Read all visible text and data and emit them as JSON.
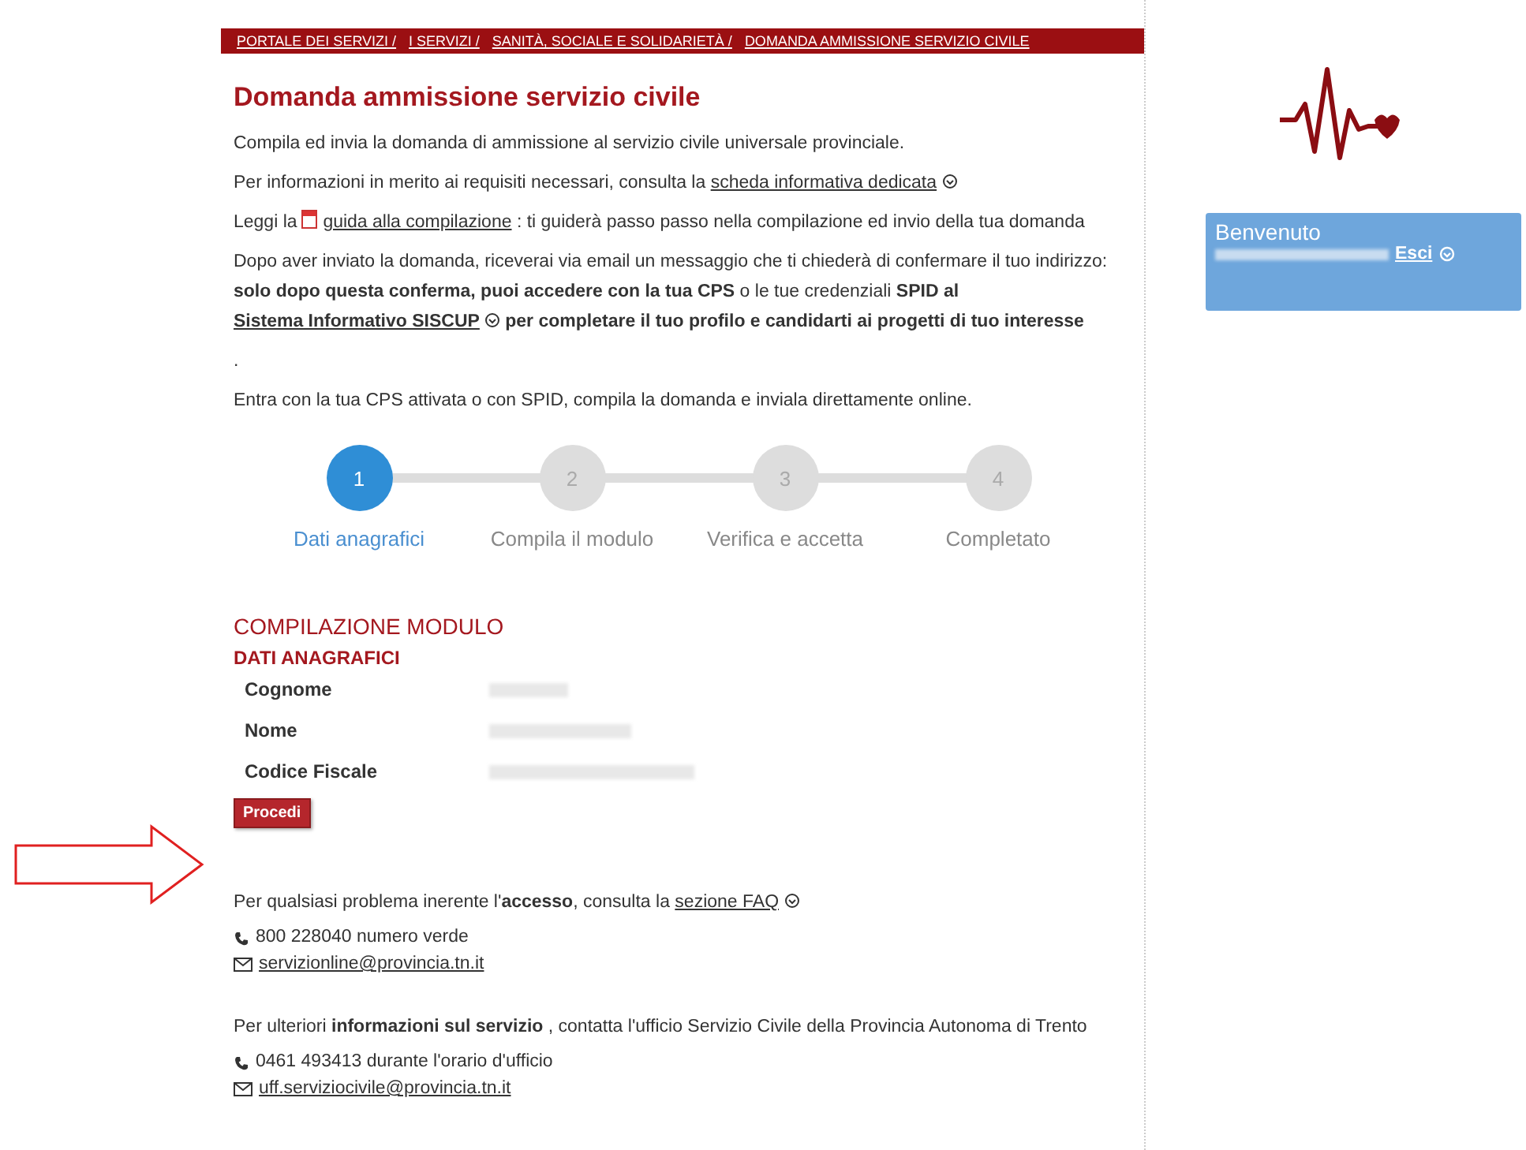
{
  "breadcrumb": [
    "PORTALE DEI SERVIZI /",
    "I SERVIZI /",
    "SANITÀ, SOCIALE E SOLIDARIETÀ /",
    "DOMANDA AMMISSIONE SERVIZIO CIVILE"
  ],
  "title": "Domanda ammissione servizio civile",
  "paragraphs": [
    [
      {
        "kind": "text",
        "text": "Compila ed invia la domanda di ammissione al servizio civile universale provinciale."
      }
    ],
    [
      {
        "kind": "text",
        "text": "Per informazioni in merito ai requisiti necessari, consulta la "
      },
      {
        "kind": "link",
        "text": "scheda informativa dedicata"
      }
    ],
    [
      {
        "kind": "text",
        "text": "Leggi la "
      },
      {
        "kind": "pdf-link",
        "text": "guida alla compilazione"
      },
      {
        "kind": "text",
        "text": " : ti guiderà passo passo nella compilazione ed invio della tua domanda"
      }
    ],
    [
      {
        "kind": "text",
        "text": "Dopo aver inviato la domanda, riceverai via email un messaggio che ti chiederà di confermare il tuo indirizzo: **solo dopo questa conferma, puoi accedere con la tua CPS** o le tue credenziali **SPID al** "
      },
      {
        "kind": "link",
        "text": "Sistema Informativo SISCUP",
        "bold": true
      },
      {
        "kind": "text",
        "text": " **per completare il tuo profilo e candidarti ai progetti di tuo interesse**"
      }
    ],
    [
      {
        "kind": "text",
        "text": "."
      }
    ],
    [
      {
        "kind": "text",
        "text": "Entra con la tua CPS attivata o con SPID, compila la domanda e inviala direttamente online."
      }
    ]
  ],
  "steps": [
    {
      "number": "1",
      "label": "Dati anagrafici",
      "selected": true
    },
    {
      "number": "2",
      "label": "Compila il modulo",
      "selected": false
    },
    {
      "number": "3",
      "label": "Verifica e accetta",
      "selected": false
    },
    {
      "number": "4",
      "label": "Completato",
      "selected": false
    }
  ],
  "form": {
    "heading": "COMPILAZIONE MODULO",
    "subheading": "DATI ANAGRAFICI",
    "fields": [
      {
        "label": "Cognome"
      },
      {
        "label": "Nome"
      },
      {
        "label": "Codice Fiscale"
      }
    ],
    "button": "Procedi"
  },
  "contacts": [
    {
      "intro": [
        {
          "kind": "text",
          "text": "Per qualsiasi problema inerente l'**accesso**, consulta la "
        },
        {
          "kind": "link",
          "text": "sezione FAQ"
        }
      ],
      "phone": "800 228040 numero verde",
      "email": "servizionline@provincia.tn.it"
    },
    {
      "intro": [
        {
          "kind": "text",
          "text": "Per ulteriori **informazioni sul servizio** , contatta l'ufficio Servizio Civile della Provincia Autonoma di Trento"
        }
      ],
      "phone": "0461 493413 durante l'orario d'ufficio",
      "email": "uff.serviziocivile@provincia.tn.it"
    }
  ],
  "sidebar": {
    "welcome": "Benvenuto",
    "logout": "Esci"
  }
}
